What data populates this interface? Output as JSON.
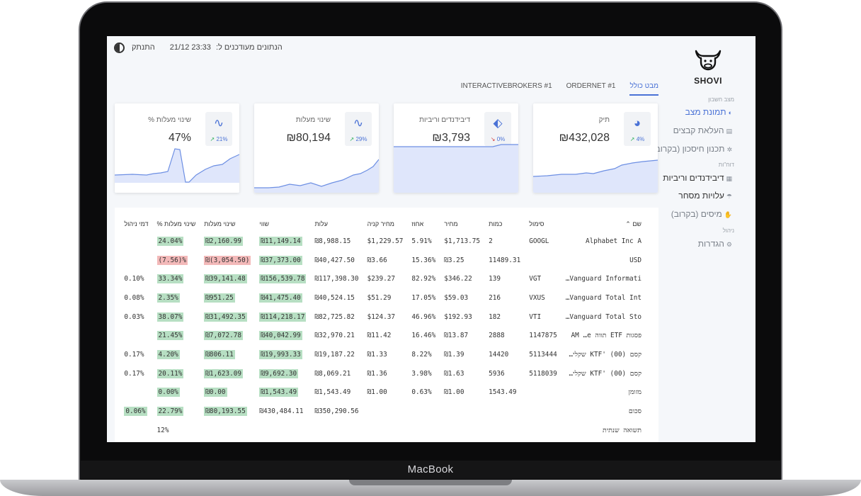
{
  "device": {
    "brand": "MacBook"
  },
  "app": {
    "logo_text": "SHOVI"
  },
  "topbar": {
    "updated_label": "הנתונים מעודכנים ל:",
    "updated_value": "23:33 21/12",
    "logout": "התנתק"
  },
  "sidebar": {
    "section1": "מצב חשבון",
    "items1": [
      {
        "label": "תמונת מצב",
        "icon": "globe-icon",
        "glyph": "◐"
      },
      {
        "label": "העלאת קבצים",
        "icon": "file-icon",
        "glyph": "▤"
      },
      {
        "label": "תכנון חיסכון (בקרוב)",
        "icon": "gear-icon",
        "glyph": "✲"
      }
    ],
    "section2": "דוח\"ות",
    "items2": [
      {
        "label": "דיבידנדים וריביות",
        "icon": "calendar-icon",
        "glyph": "▦"
      },
      {
        "label": "עלויות מסחר",
        "icon": "umbrella-icon",
        "glyph": "☂"
      },
      {
        "label": "מיסים (בקרוב)",
        "icon": "hand-icon",
        "glyph": "✋"
      }
    ],
    "section3": "ניהול",
    "items3": [
      {
        "label": "הגדרות",
        "icon": "sliders-icon",
        "glyph": "⚙"
      }
    ]
  },
  "tabs": [
    "מבט כולל",
    "ORDERNET #1",
    "INTERACTIVEBROKERS #1"
  ],
  "cards": [
    {
      "title": "תיק",
      "value": "₪432,028",
      "pct": "4%",
      "trend": "up",
      "icon": "pie-chart-icon",
      "glyph": "◕"
    },
    {
      "title": "דיבידנדים וריביות",
      "value": "₪3,793",
      "pct": "0%",
      "trend": "down",
      "icon": "tag-icon",
      "glyph": "⬖"
    },
    {
      "title": "שינוי מעלות",
      "value": "₪80,194",
      "pct": "29%",
      "trend": "up",
      "icon": "pulse-icon",
      "glyph": "∿"
    },
    {
      "title": "שינוי מעלות %",
      "value": "47%",
      "pct": "21%",
      "trend": "up",
      "icon": "pulse-icon",
      "glyph": "∿"
    }
  ],
  "table": {
    "headers": [
      "שם ⌃",
      "סימול",
      "כמות",
      "מחיר",
      "אחוז",
      "מחיר קניה",
      "עלות",
      "שווי",
      "שינוי מעלות",
      "שינוי מעלות %",
      "דמי ניהול"
    ],
    "rows": [
      [
        "Alphabet Inc A",
        "GOOGL",
        "2",
        "$1,713.75",
        "5.91%",
        "$1,229.57",
        "₪8,988.15",
        "₪11,149.14",
        "₪2,160.99",
        "24.04%",
        ""
      ],
      [
        "USD",
        "",
        "11489.31",
        "₪3.25",
        "15.36%",
        "₪3.66",
        "₪40,427.50",
        "₪37,373.00",
        "₪(3,054.50)",
        "(7.56)%",
        ""
      ],
      [
        "Vanguard Informati…",
        "VGT",
        "139",
        "$346.22",
        "82.92%",
        "$239.27",
        "₪117,398.30",
        "₪156,539.78",
        "₪39,141.48",
        "33.34%",
        "0.10%"
      ],
      [
        "Vanguard Total Int…",
        "VXUS",
        "216",
        "$59.03",
        "17.05%",
        "$51.29",
        "₪40,524.15",
        "₪41,475.40",
        "₪951.25",
        "2.35%",
        "0.08%"
      ],
      [
        "Vanguard Total Sto…",
        "VTI",
        "182",
        "$192.93",
        "46.96%",
        "$124.37",
        "₪82,725.82",
        "₪114,218.17",
        "₪31,492.35",
        "38.07%",
        "0.03%"
      ],
      [
        "פסגות ETF תווה AM …e",
        "1147875",
        "2888",
        "₪13.87",
        "16.46%",
        "₪11.42",
        "₪32,970.21",
        "₪40,042.99",
        "₪7,072.78",
        "21.45%",
        ""
      ],
      [
        "קסם KTF' (00) שקלי…",
        "5113444",
        "14420",
        "₪1.39",
        "8.22%",
        "₪1.33",
        "₪19,187.22",
        "₪19,993.33",
        "₪806.11",
        "4.20%",
        "0.17%"
      ],
      [
        "קסם KTF' (00) שקלי…",
        "5118039",
        "5936",
        "₪1.63",
        "3.98%",
        "₪1.36",
        "₪8,069.21",
        "₪9,692.30",
        "₪1,623.09",
        "20.11%",
        "0.17%"
      ],
      [
        "מזומן",
        "",
        "1543.49",
        "₪1.00",
        "0.63%",
        "₪1.00",
        "₪1,543.49",
        "₪1,543.49",
        "₪0.00",
        "0.00%",
        ""
      ],
      [
        "סכום",
        "",
        "",
        "",
        "",
        "",
        "₪350,290.56",
        "₪430,484.11",
        "₪80,193.55",
        "22.79%",
        "0.06%"
      ],
      [
        "תשואה שנתית",
        "",
        "",
        "",
        "",
        "",
        "",
        "",
        "",
        "12%",
        ""
      ]
    ],
    "highlights": [
      [
        "",
        "",
        "",
        "",
        "",
        "",
        "",
        "pos",
        "pos",
        "pos",
        ""
      ],
      [
        "",
        "",
        "",
        "",
        "",
        "",
        "",
        "pos",
        "neg",
        "neg",
        ""
      ],
      [
        "",
        "",
        "",
        "",
        "",
        "",
        "",
        "pos",
        "pos",
        "pos",
        ""
      ],
      [
        "",
        "",
        "",
        "",
        "",
        "",
        "",
        "pos",
        "pos",
        "pos",
        ""
      ],
      [
        "",
        "",
        "",
        "",
        "",
        "",
        "",
        "pos",
        "pos",
        "pos",
        ""
      ],
      [
        "",
        "",
        "",
        "",
        "",
        "",
        "",
        "pos",
        "pos",
        "pos",
        ""
      ],
      [
        "",
        "",
        "",
        "",
        "",
        "",
        "",
        "pos",
        "pos",
        "pos",
        ""
      ],
      [
        "",
        "",
        "",
        "",
        "",
        "",
        "",
        "pos",
        "pos",
        "pos",
        ""
      ],
      [
        "",
        "",
        "",
        "",
        "",
        "",
        "",
        "pos",
        "pos",
        "pos",
        ""
      ],
      [
        "",
        "",
        "",
        "",
        "",
        "",
        "",
        "",
        "pos",
        "pos",
        "pos"
      ],
      [
        "",
        "",
        "",
        "",
        "",
        "",
        "",
        "",
        "",
        "",
        ""
      ]
    ]
  },
  "colors": {
    "accent": "#4a72d6",
    "positive": "#b7dfc3",
    "negative": "#f3b9b9",
    "spark_fill": "#dfe6fb",
    "spark_line": "#6d8fe3"
  }
}
